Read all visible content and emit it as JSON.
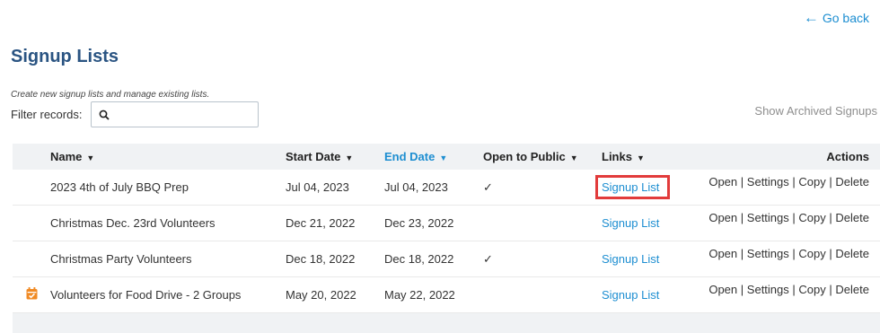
{
  "nav": {
    "go_back_label": "Go back"
  },
  "page": {
    "title": "Signup Lists",
    "description": "Create new signup lists and manage existing lists.",
    "filter_label": "Filter records:",
    "filter_value": "",
    "show_archived_label": "Show Archived Signups"
  },
  "table": {
    "columns": {
      "name": "Name",
      "start_date": "Start Date",
      "end_date": "End Date",
      "open_to_public": "Open to Public",
      "links": "Links",
      "actions": "Actions"
    },
    "sorted_column": "end_date",
    "rows": [
      {
        "icon": "",
        "name": "2023 4th of July BBQ Prep",
        "start_date": "Jul 04, 2023",
        "end_date": "Jul 04, 2023",
        "open_check": "✓",
        "link_label": "Signup List",
        "highlighted": true
      },
      {
        "icon": "",
        "name": "Christmas Dec. 23rd Volunteers",
        "start_date": "Dec 21, 2022",
        "end_date": "Dec 23, 2022",
        "open_check": "",
        "link_label": "Signup List",
        "highlighted": false
      },
      {
        "icon": "",
        "name": "Christmas Party Volunteers",
        "start_date": "Dec 18, 2022",
        "end_date": "Dec 18, 2022",
        "open_check": "✓",
        "link_label": "Signup List",
        "highlighted": false
      },
      {
        "icon": "calendar-check-icon",
        "name": "Volunteers for Food Drive - 2 Groups",
        "start_date": "May 20, 2022",
        "end_date": "May 22, 2022",
        "open_check": "",
        "link_label": "Signup List",
        "highlighted": false
      }
    ],
    "actions": {
      "open": "Open",
      "settings": "Settings",
      "copy": "Copy",
      "delete": "Delete",
      "separator": "|"
    }
  },
  "colors": {
    "accent": "#1d8ed1",
    "title": "#2a5482",
    "highlight_border": "#e23b3b",
    "calendar_icon": "#f08a24",
    "header_bg": "#f0f2f4"
  }
}
